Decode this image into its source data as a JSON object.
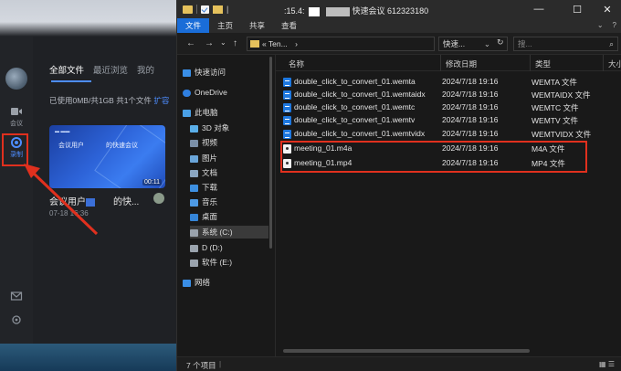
{
  "meeting_app": {
    "rail": {
      "meeting_label": "会议",
      "record_label": "录制"
    },
    "tabs": [
      "全部文件",
      "最近浏览",
      "我的"
    ],
    "storage": {
      "text": "已使用0MB/共1GB  共1个文件",
      "expand_link": "扩容"
    },
    "recording": {
      "thumb_left_text": "会议用户",
      "thumb_right_text": "的快速会议",
      "duration": "00:11",
      "title_prefix": "会议用户",
      "title_suffix": "的快...",
      "date": "07-18 16:36"
    }
  },
  "explorer": {
    "title": {
      "prefix": "|",
      "mid": ":15.4:",
      "suffix": "快速会议 612323180"
    },
    "window_controls": [
      "—",
      "☐",
      "✕"
    ],
    "ribbon": {
      "file": "文件",
      "items": [
        "主页",
        "共享",
        "查看"
      ],
      "right": [
        "⌄",
        "?"
      ]
    },
    "address": {
      "back": "←",
      "forward": "→",
      "history": "⌄",
      "up": "↑",
      "path": "« Ten...",
      "breadcrumb_chevron": "›",
      "search_value": "快速...",
      "search_chevron": "⌄",
      "refresh": "↻",
      "search2_placeholder": "搜...",
      "search2_icon": "⌕"
    },
    "nav_pane": {
      "items": [
        {
          "label": "快速访问",
          "icon": "star-icon",
          "color": "#3a8ee6"
        },
        {
          "label": "OneDrive",
          "icon": "cloud-icon",
          "color": "#2f7fe0"
        },
        {
          "label": "此电脑",
          "icon": "computer-icon",
          "color": "#4aa0e6"
        },
        {
          "label": "3D 对象",
          "icon": "cube-icon",
          "color": "#5aaee8"
        },
        {
          "label": "视频",
          "icon": "video-icon",
          "color": "#7a8fa8"
        },
        {
          "label": "图片",
          "icon": "picture-icon",
          "color": "#6aa5d9"
        },
        {
          "label": "文档",
          "icon": "document-icon",
          "color": "#8aa6c2"
        },
        {
          "label": "下载",
          "icon": "download-icon",
          "color": "#3d8fe0"
        },
        {
          "label": "音乐",
          "icon": "music-icon",
          "color": "#4d9ae5"
        },
        {
          "label": "桌面",
          "icon": "desktop-icon",
          "color": "#3585d8"
        },
        {
          "label": "系统 (C:)",
          "icon": "drive-icon",
          "color": "#9aa3ad"
        },
        {
          "label": "D (D:)",
          "icon": "drive-icon",
          "color": "#9aa3ad"
        },
        {
          "label": "软件 (E:)",
          "icon": "drive-icon",
          "color": "#9aa3ad"
        },
        {
          "label": "网络",
          "icon": "network-icon",
          "color": "#3a8ee6"
        }
      ]
    },
    "columns": {
      "name": "名称",
      "modified": "修改日期",
      "type": "类型",
      "size": "大小"
    },
    "files": [
      {
        "name": "double_click_to_convert_01.wemta",
        "modified": "2024/7/18 19:16",
        "type": "WEMTA 文件",
        "icon": "file-icon"
      },
      {
        "name": "double_click_to_convert_01.wemtaidx",
        "modified": "2024/7/18 19:16",
        "type": "WEMTAIDX 文件",
        "icon": "file-icon"
      },
      {
        "name": "double_click_to_convert_01.wemtc",
        "modified": "2024/7/18 19:16",
        "type": "WEMTC 文件",
        "icon": "file-icon"
      },
      {
        "name": "double_click_to_convert_01.wemtv",
        "modified": "2024/7/18 19:16",
        "type": "WEMTV 文件",
        "icon": "file-icon"
      },
      {
        "name": "double_click_to_convert_01.wemtvidx",
        "modified": "2024/7/18 19:16",
        "type": "WEMTVIDX 文件",
        "icon": "file-icon"
      },
      {
        "name": "meeting_01.m4a",
        "modified": "2024/7/18 19:16",
        "type": "M4A 文件",
        "icon": "media-icon"
      },
      {
        "name": "meeting_01.mp4",
        "modified": "2024/7/18 19:16",
        "type": "MP4 文件",
        "icon": "media-icon"
      }
    ],
    "status": {
      "count": "7 个项目",
      "sep": "|"
    }
  },
  "colors": {
    "accent": "#1a6dd8",
    "highlight_box": "#e0301e",
    "app_accent": "#4d8dff"
  }
}
